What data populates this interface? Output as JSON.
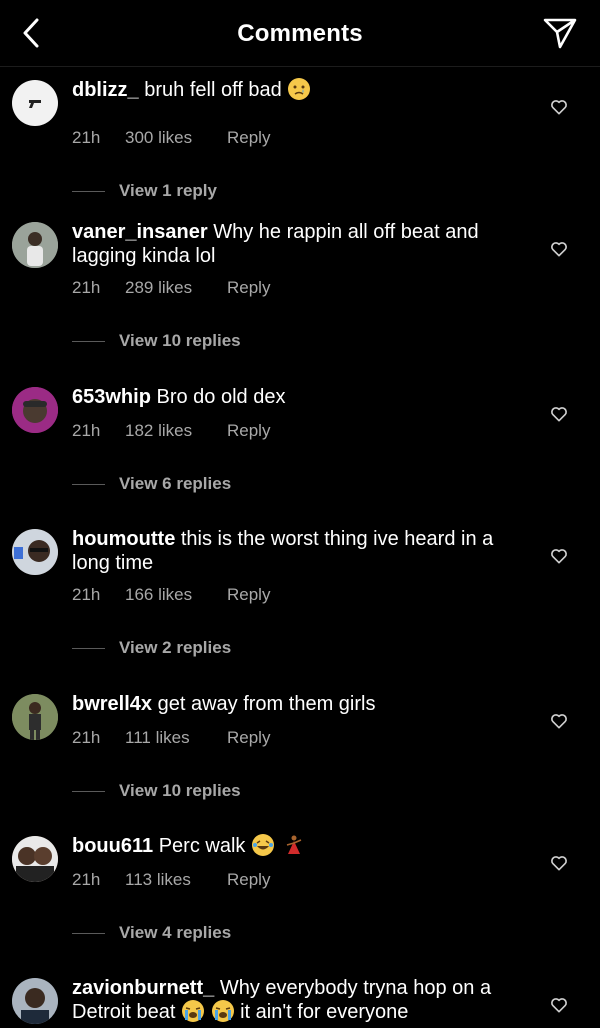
{
  "header": {
    "title": "Comments",
    "back_icon": "chevron-left-icon",
    "share_icon": "paper-plane-icon"
  },
  "comments": [
    {
      "username": "dblizz_",
      "text": "bruh fell off bad",
      "emoji": [
        "crying-face"
      ],
      "time": "21h",
      "likes": "300 likes",
      "reply": "Reply",
      "view_replies": "View 1 reply",
      "avatar_color": "#f2f2f2"
    },
    {
      "username": "vaner_insaner",
      "text": "Why he rappin all off beat and lagging kinda lol",
      "emoji": [],
      "time": "21h",
      "likes": "289 likes",
      "reply": "Reply",
      "view_replies": "View 10 replies",
      "avatar_color": "#8a8f86"
    },
    {
      "username": "653whip",
      "text": "Bro do old dex",
      "emoji": [],
      "time": "21h",
      "likes": "182 likes",
      "reply": "Reply",
      "view_replies": "View 6 replies",
      "avatar_color": "#a52a8a"
    },
    {
      "username": "houmoutte",
      "text": "this is the worst thing ive heard in a long time",
      "emoji": [],
      "time": "21h",
      "likes": "166 likes",
      "reply": "Reply",
      "view_replies": "View 2 replies",
      "avatar_color": "#5b4a3e"
    },
    {
      "username": "bwrell4x",
      "text": "get away from them girls",
      "emoji": [],
      "time": "21h",
      "likes": "111 likes",
      "reply": "Reply",
      "view_replies": "View 10 replies",
      "avatar_color": "#6f7f56"
    },
    {
      "username": "bouu611",
      "text": "Perc walk",
      "emoji": [
        "laughing-face",
        "dancer"
      ],
      "time": "21h",
      "likes": "113 likes",
      "reply": "Reply",
      "view_replies": "View 4 replies",
      "avatar_color": "#8a6a55"
    },
    {
      "username": "zavionburnett_",
      "text": "Why everybody tryna hop on a Detroit beat",
      "text_after": "it ain't for everyone",
      "emoji": [
        "loudly-crying-face",
        "loudly-crying-face"
      ],
      "time": "",
      "likes": "",
      "reply": "",
      "view_replies": "",
      "avatar_color": "#2d3a45"
    }
  ],
  "icons": {
    "like": "heart-outline-icon"
  }
}
